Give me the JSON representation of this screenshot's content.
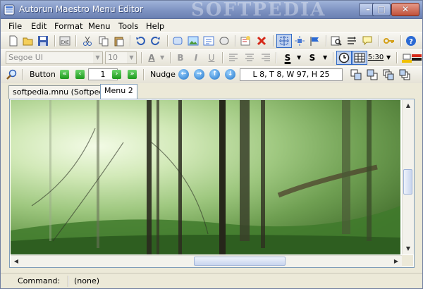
{
  "window": {
    "title": "Autorun Maestro Menu Editor",
    "watermark": "SOFTPEDIA",
    "controls": {
      "minimize": "–",
      "maximize": "□",
      "close": "✕"
    }
  },
  "menu": [
    "File",
    "Edit",
    "Format",
    "Menu",
    "Tools",
    "Help"
  ],
  "format_toolbar": {
    "font": "Segoe UI",
    "size": "10",
    "font_color_label": "A",
    "bold": "B",
    "italic": "I",
    "underline": "U",
    "strike_label": "S",
    "shadow_label": "S",
    "time_label": "5:30"
  },
  "button_toolbar": {
    "object_label": "Button",
    "index": "1",
    "nudge_label": "Nudge",
    "coords": "L 8, T 8, W 97, H 25"
  },
  "tabs": [
    {
      "label": "softpedia.mnu (Softpedia)",
      "active": false
    },
    {
      "label": "Menu 2",
      "active": true
    }
  ],
  "status": {
    "label": "Command:",
    "value": "(none)"
  },
  "colors": {
    "title_gradient": "#7e93c2",
    "accent": "#316ac5",
    "forest_light": "#d2e9b8",
    "forest_dark": "#446f2e"
  },
  "icons": {
    "main": [
      "new-icon",
      "open-icon",
      "save-icon",
      "build-exe-icon",
      "cut-icon",
      "copy-icon",
      "paste-icon",
      "undo-icon",
      "redo-icon",
      "add-button-icon",
      "add-image-icon",
      "add-text-icon",
      "add-shape-icon",
      "properties-icon",
      "delete-icon",
      "grid-select-icon",
      "distribute-icon",
      "flag-icon",
      "preview-icon",
      "sequence-icon",
      "comment-icon",
      "key-icon",
      "help-icon"
    ]
  }
}
